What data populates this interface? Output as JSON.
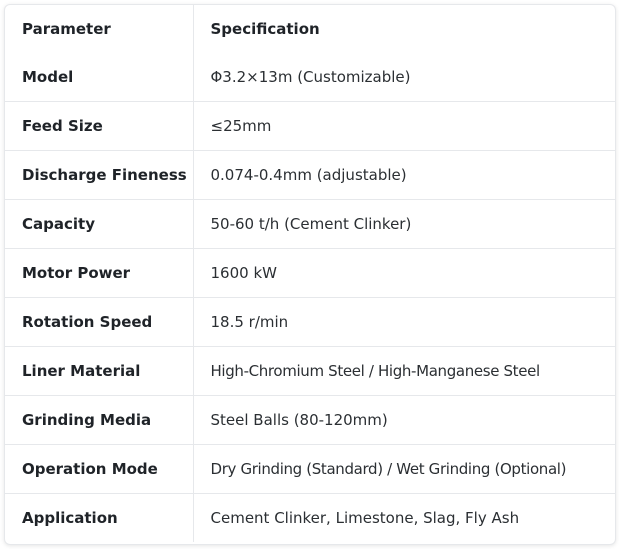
{
  "table": {
    "headers": [
      "Parameter",
      "Specification"
    ],
    "rows": [
      {
        "parameter": "Model",
        "specification": "Φ3.2×13m (Customizable)"
      },
      {
        "parameter": "Feed Size",
        "specification": "≤25mm"
      },
      {
        "parameter": "Discharge Fineness",
        "specification": "0.074-0.4mm (adjustable)"
      },
      {
        "parameter": "Capacity",
        "specification": "50-60 t/h (Cement Clinker)"
      },
      {
        "parameter": "Motor Power",
        "specification": "1600 kW"
      },
      {
        "parameter": "Rotation Speed",
        "specification": "18.5 r/min"
      },
      {
        "parameter": "Liner Material",
        "specification": "High-Chromium Steel / High-Manganese Steel"
      },
      {
        "parameter": "Grinding Media",
        "specification": "Steel Balls (80-120mm)"
      },
      {
        "parameter": "Operation Mode",
        "specification": "Dry Grinding (Standard) / Wet Grinding (Optional)"
      },
      {
        "parameter": "Application",
        "specification": "Cement Clinker, Limestone, Slag, Fly Ash"
      }
    ]
  }
}
